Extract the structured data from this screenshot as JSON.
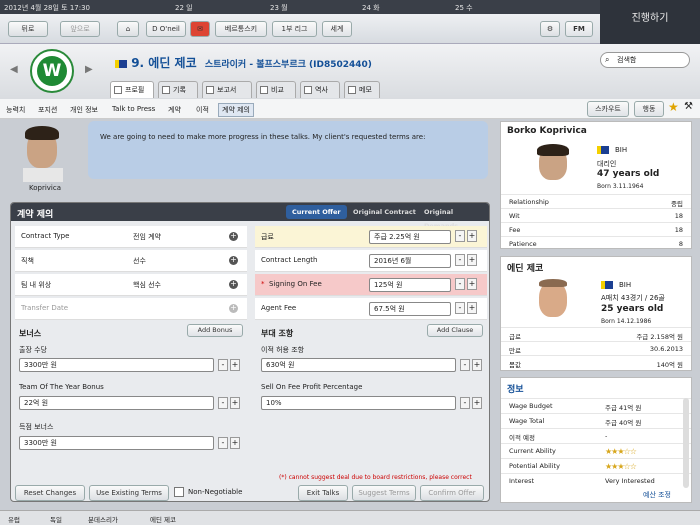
{
  "topbar": {
    "date": "2012년 4월 28일 토 17:30",
    "cal": [
      "22 일",
      "23 월",
      "24 화",
      "25 수"
    ]
  },
  "nav": {
    "back": "뒤로",
    "forward": "앞으로",
    "manager": "D O'neil",
    "club": "베르통스키",
    "league": "1부 리그",
    "world": "세계",
    "fm": "FM"
  },
  "continue": "진행하기",
  "header": {
    "title": "9. 에딘 제코",
    "subtitle": "스트라이커 - 볼프스부르크 (ID8502440)",
    "search": "검색함",
    "crest": "W"
  },
  "tabs": [
    "프로필",
    "기록",
    "보고서",
    "비교",
    "역사",
    "메모"
  ],
  "subnav": [
    "능력치",
    "포지션",
    "개인 정보",
    "Talk to Press",
    "계약",
    "이적",
    "계약 제의"
  ],
  "subnav_right": {
    "scout": "스카우트",
    "action": "행동"
  },
  "agent": {
    "name": "Koprivica",
    "message": "We are going to need to make more progress in these talks. My client's requested terms are:"
  },
  "panel": {
    "title": "계약 제의",
    "tabs": [
      "Current Offer",
      "Original Contract",
      "Original Demands"
    ],
    "left": [
      {
        "label": "Contract Type",
        "value": "전임 계약"
      },
      {
        "label": "직책",
        "value": "선수"
      },
      {
        "label": "팀 내 위상",
        "value": "핵심 선수"
      },
      {
        "label": "Transfer Date",
        "value": ""
      }
    ],
    "right": [
      {
        "label": "급료",
        "value": "주급 2.25억 원"
      },
      {
        "label": "Contract Length",
        "value": "2016년 6월"
      },
      {
        "label": "Signing On Fee",
        "value": "125억 원",
        "mark": "*"
      },
      {
        "label": "Agent Fee",
        "value": "67.5억 원"
      }
    ],
    "bonus_title": "보너스",
    "add_bonus": "Add Bonus",
    "bonuses": [
      {
        "label": "출장 수당",
        "value": "3300만 원"
      },
      {
        "label": "Team Of The Year Bonus",
        "value": "22억 원"
      },
      {
        "label": "득점 보너스",
        "value": "3300만 원"
      }
    ],
    "clause_title": "부대 조항",
    "add_clause": "Add Clause",
    "clauses": [
      {
        "label": "이적 허용 조항",
        "value": "630억 원"
      },
      {
        "label": "Sell On Fee Profit Percentage",
        "value": "10%"
      }
    ],
    "note": "(*) cannot suggest deal due to board restrictions, please correct",
    "buttons": {
      "reset": "Reset Changes",
      "existing": "Use Existing Terms",
      "nonneg": "Non-Negotiable",
      "exit": "Exit Talks",
      "suggest": "Suggest Terms",
      "confirm": "Confirm Offer"
    }
  },
  "agent_card": {
    "name": "Borko Koprivica",
    "nation": "BIH",
    "role": "대리인",
    "age": "47 years old",
    "born": "Born 3.11.1964",
    "rows": [
      {
        "k": "Relationship",
        "v": "중립"
      },
      {
        "k": "Wit",
        "v": "18"
      },
      {
        "k": "Fee",
        "v": "18"
      },
      {
        "k": "Patience",
        "v": "8"
      }
    ]
  },
  "player_card": {
    "name": "에딘 제코",
    "nation": "BIH",
    "caps": "A매치 43경기 / 26골",
    "age": "25 years old",
    "born": "Born 14.12.1986",
    "rows": [
      {
        "k": "급료",
        "v": "주급 2.158억 원"
      },
      {
        "k": "만료",
        "v": "30.6.2013"
      },
      {
        "k": "몸값",
        "v": "140억 원"
      }
    ]
  },
  "finance": {
    "title": "정보",
    "rows": [
      {
        "k": "Wage Budget",
        "v": "주급 41억 원"
      },
      {
        "k": "Wage Total",
        "v": "주급 40억 원"
      },
      {
        "k": "이적 예정",
        "v": "-"
      },
      {
        "k": "Current Ability",
        "stars": "★★★☆☆"
      },
      {
        "k": "Potential Ability",
        "stars": "★★★☆☆"
      },
      {
        "k": "Interest",
        "v": "Very Interested"
      }
    ],
    "link": "예산 조정"
  },
  "bottom": [
    "유럽",
    "독일",
    "분데스리가",
    "에딘 제코"
  ]
}
